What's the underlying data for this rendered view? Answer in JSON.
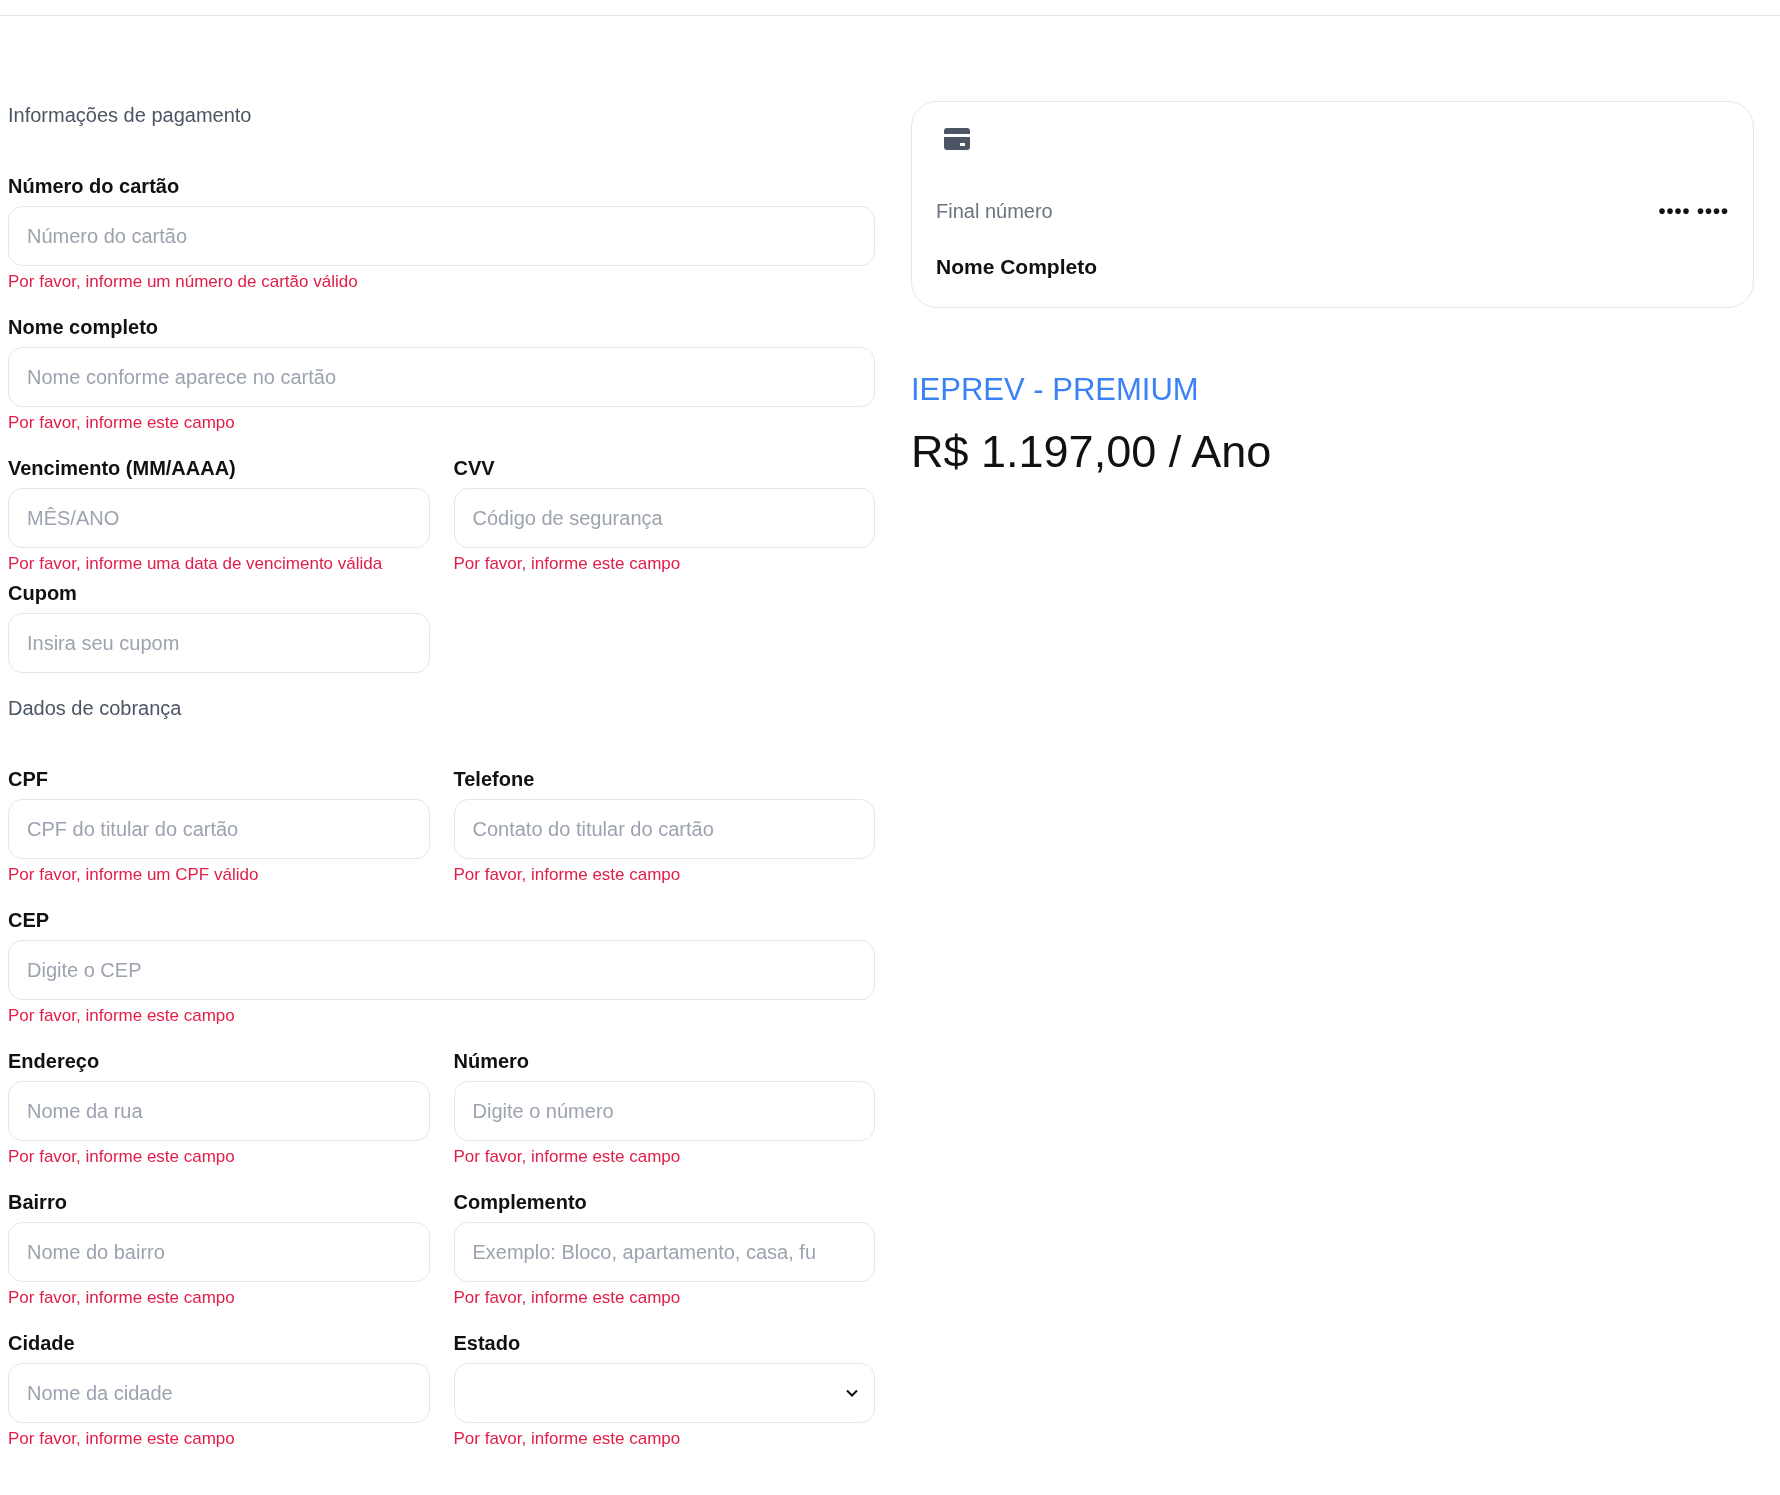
{
  "sections": [
    {
      "title": "Informações de pagamento",
      "rows": [
        [
          {
            "kind": "text",
            "wide": true,
            "label": "Número do cartão",
            "placeholder": "Número do cartão",
            "error": "Por favor, informe um número de cartão válido"
          }
        ],
        [
          {
            "kind": "text",
            "wide": true,
            "label": "Nome completo",
            "placeholder": "Nome conforme aparece no cartão",
            "error": "Por favor, informe este campo"
          }
        ],
        [
          {
            "kind": "text",
            "wide": false,
            "label": "Vencimento (MM/AAAA)",
            "placeholder": "MÊS/ANO",
            "error": "Por favor, informe uma data de vencimento válida"
          },
          {
            "kind": "text",
            "wide": false,
            "label": "CVV",
            "placeholder": "Código de segurança",
            "error": "Por favor, informe este campo"
          }
        ],
        [
          {
            "kind": "text",
            "wide": false,
            "label": "Cupom",
            "placeholder": "Insira seu cupom"
          }
        ]
      ]
    },
    {
      "title": "Dados de cobrança",
      "rows": [
        [
          {
            "kind": "text",
            "wide": false,
            "label": "CPF",
            "placeholder": "CPF do titular do cartão",
            "error": "Por favor, informe um CPF válido"
          },
          {
            "kind": "text",
            "wide": false,
            "label": "Telefone",
            "placeholder": "Contato do titular do cartão",
            "error": "Por favor, informe este campo"
          }
        ],
        [
          {
            "kind": "text",
            "wide": true,
            "label": "CEP",
            "placeholder": "Digite o CEP",
            "error": "Por favor, informe este campo"
          }
        ],
        [
          {
            "kind": "text",
            "wide": false,
            "label": "Endereço",
            "placeholder": "Nome da rua",
            "error": "Por favor, informe este campo"
          },
          {
            "kind": "text",
            "wide": false,
            "label": "Número",
            "placeholder": "Digite o número",
            "error": "Por favor, informe este campo"
          }
        ],
        [
          {
            "kind": "text",
            "wide": false,
            "label": "Bairro",
            "placeholder": "Nome do bairro",
            "error": "Por favor, informe este campo"
          },
          {
            "kind": "text",
            "wide": false,
            "label": "Complemento",
            "placeholder": "Exemplo: Bloco, apartamento, casa, fu",
            "error": "Por favor, informe este campo"
          }
        ],
        [
          {
            "kind": "text",
            "wide": false,
            "label": "Cidade",
            "placeholder": "Nome da cidade",
            "error": "Por favor, informe este campo"
          },
          {
            "kind": "select",
            "wide": false,
            "label": "Estado",
            "error": "Por favor, informe este campo"
          }
        ]
      ]
    }
  ],
  "card_preview": {
    "number_label": "Final número",
    "number_mask": "•••• ••••",
    "name": "Nome Completo"
  },
  "plan": {
    "name": "IEPREV - PREMIUM",
    "price": "R$ 1.197,00 / Ano"
  }
}
